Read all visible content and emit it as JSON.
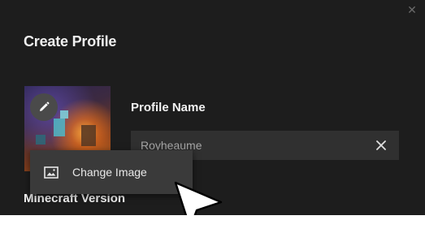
{
  "dialog": {
    "title": "Create Profile",
    "close_icon": "close-icon"
  },
  "profile_image": {
    "edit_icon": "pencil-icon"
  },
  "profile_name": {
    "label": "Profile Name",
    "value": "Royheaume",
    "clear_icon": "clear-icon"
  },
  "minecraft_version": {
    "label": "Minecraft Version"
  },
  "context_menu": {
    "items": [
      {
        "label": "Change Image",
        "icon": "image-icon"
      }
    ]
  },
  "colors": {
    "dialog_bg": "#1d1d1d",
    "input_bg": "#303030",
    "menu_bg": "#3a3a3a",
    "text_primary": "#f2f2f2",
    "text_muted": "#a6a6a6"
  }
}
